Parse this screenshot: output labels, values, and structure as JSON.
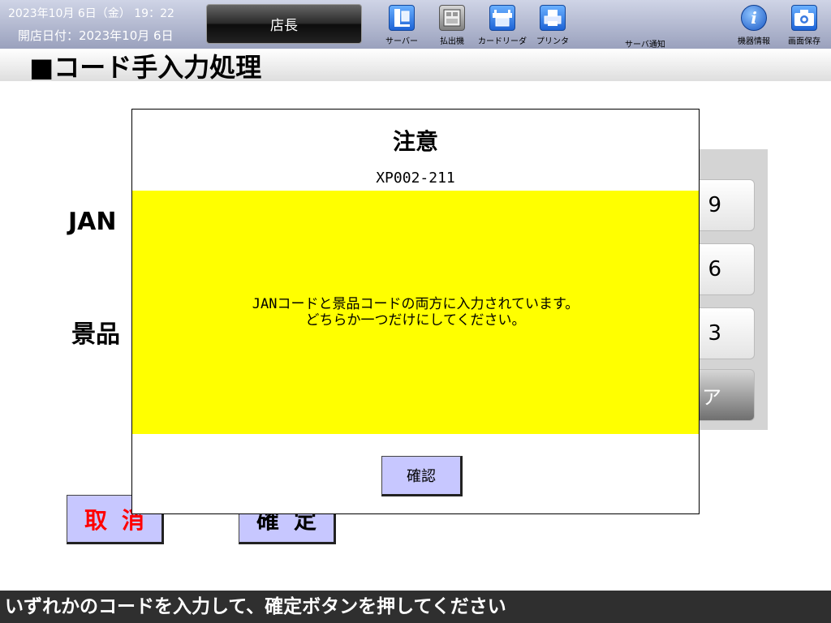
{
  "header": {
    "datetime": "2023年10月 6日（金） 19：22",
    "opening_date": "開店日付：2023年10月 6日",
    "role_button": "店長",
    "tools": [
      {
        "label": "サーバー",
        "icon": "server-icon"
      },
      {
        "label": "払出機",
        "icon": "dispenser-icon"
      },
      {
        "label": "カードリーダ",
        "icon": "card-reader-icon"
      },
      {
        "label": "プリンタ",
        "icon": "printer-icon"
      }
    ],
    "server_notice": "サーバ通知",
    "device_info": "機器情報",
    "screen_save": "画面保存"
  },
  "page": {
    "title": "■コード手入力処理",
    "jan_label": "JAN",
    "keihin_label": "景品"
  },
  "keypad": {
    "keys": [
      "9",
      "6",
      "3"
    ],
    "clear_label": "ア"
  },
  "buttons": {
    "cancel": "取消",
    "confirm": "確定"
  },
  "status_bar": {
    "message": "いずれかのコードを入力して、確定ボタンを押してください"
  },
  "dialog": {
    "title": "注意",
    "code": "XP002-211",
    "message_line1": "JANコードと景品コードの両方に入力されています。",
    "message_line2": "どちらか一つだけにしてください。",
    "ok_button": "確認",
    "message_bg": "#ffff00"
  }
}
